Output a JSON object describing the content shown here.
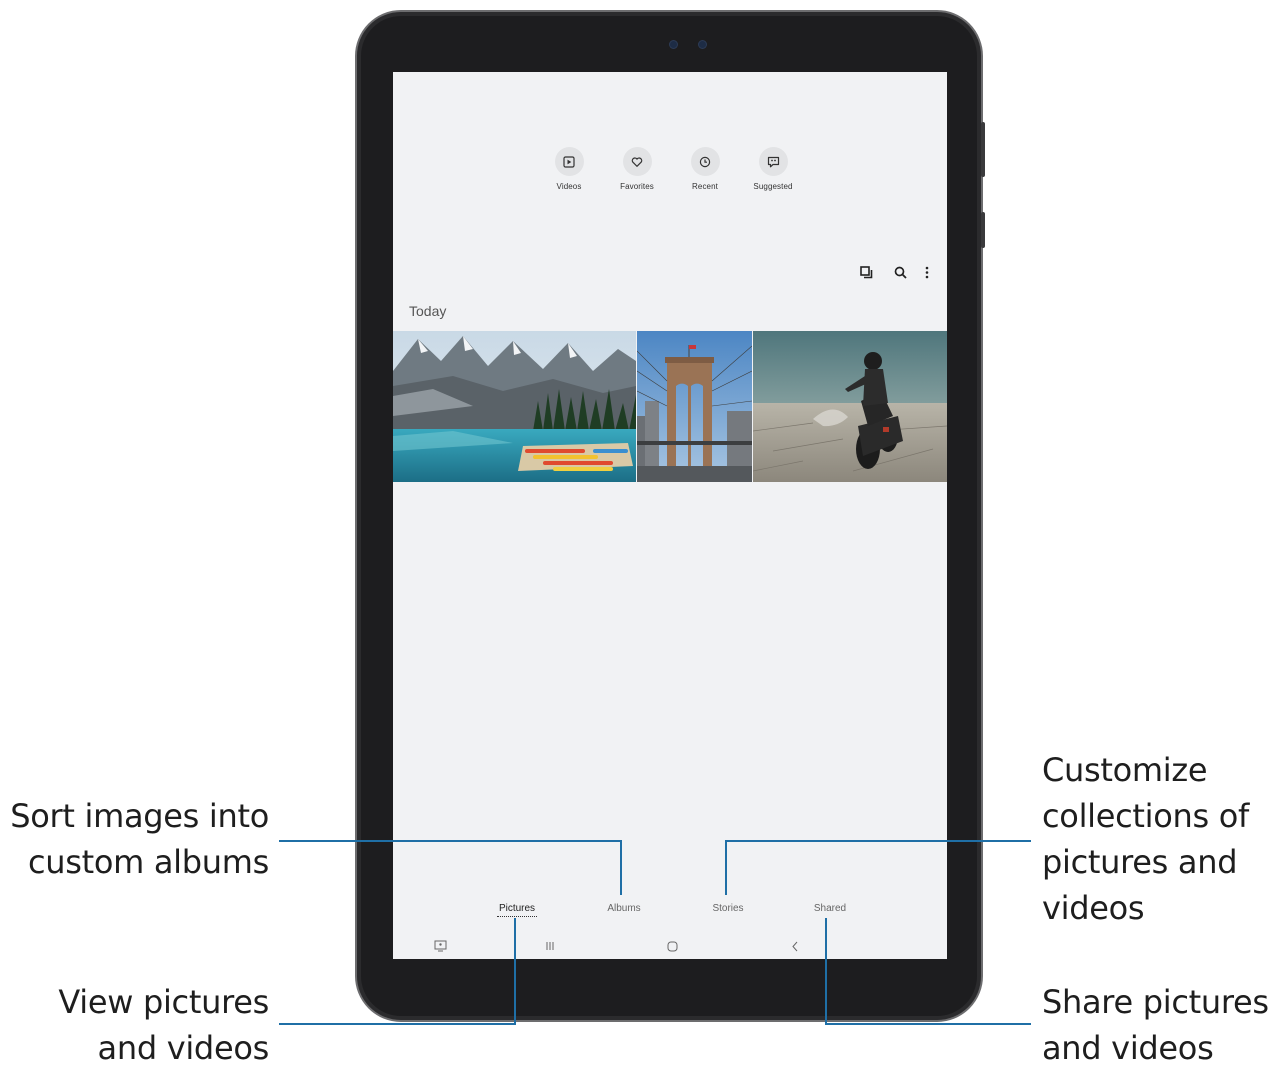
{
  "categories": [
    {
      "label": "Videos",
      "icon": "video-icon"
    },
    {
      "label": "Favorites",
      "icon": "heart-icon"
    },
    {
      "label": "Recent",
      "icon": "clock-icon"
    },
    {
      "label": "Suggested",
      "icon": "suggested-icon"
    }
  ],
  "toolbar": {
    "icons": [
      "select-icon",
      "search-icon",
      "more-options-icon"
    ]
  },
  "section_title": "Today",
  "photos": [
    "mountain-lake-photo",
    "bridge-photo",
    "motorcycle-photo"
  ],
  "tabs": [
    {
      "label": "Pictures",
      "active": true
    },
    {
      "label": "Albums",
      "active": false
    },
    {
      "label": "Stories",
      "active": false
    },
    {
      "label": "Shared",
      "active": false
    }
  ],
  "navbar": {
    "icons": [
      "screenshot-icon",
      "recent-apps-icon",
      "home-icon",
      "back-icon"
    ]
  },
  "callouts": {
    "albums": [
      "Sort images into",
      "custom albums"
    ],
    "stories": [
      "Customize",
      "collections of",
      "pictures and",
      "videos"
    ],
    "pictures": [
      "View pictures",
      "and videos"
    ],
    "shared": [
      "Share pictures",
      "and videos"
    ]
  },
  "colors": {
    "callout_line": "#1f6fa6",
    "screen_bg": "#f1f2f4",
    "bezel": "#1d1d1f"
  }
}
